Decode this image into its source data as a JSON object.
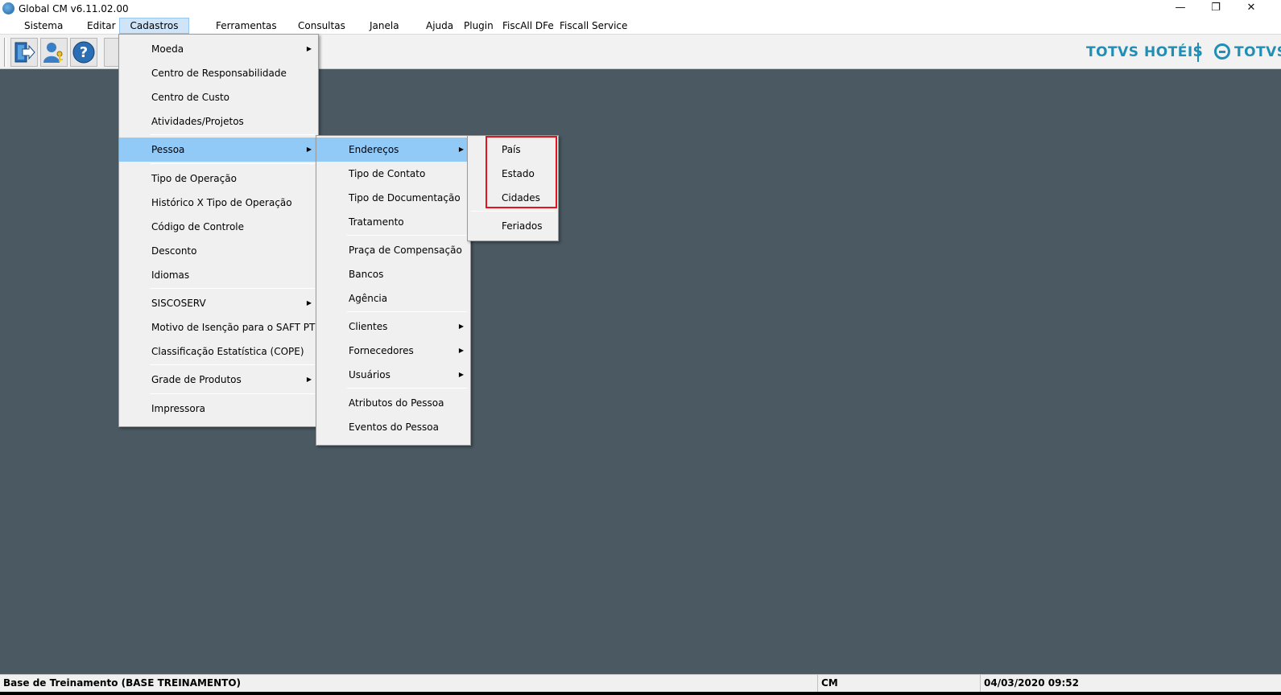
{
  "window": {
    "title": "Global CM v6.11.02.00",
    "minimize": "—",
    "maximize": "❐",
    "close": "✕"
  },
  "menubar": [
    "Sistema",
    "Editar",
    "Cadastros",
    "Ferramentas",
    "Consultas",
    "Janela",
    "Ajuda",
    "Plugin",
    "FiscAll DFe",
    "Fiscall Service"
  ],
  "toolbar": {
    "buttons": [
      "exit-icon",
      "user-key-icon",
      "help-icon"
    ],
    "brand_hotel": "TOTVS HOTÉIS",
    "brand_totvs": "TOTVS"
  },
  "menu_cadastros": {
    "moeda": "Moeda",
    "centro_resp": "Centro de Responsabilidade",
    "centro_custo": "Centro de Custo",
    "atividades": "Atividades/Projetos",
    "pessoa": "Pessoa",
    "tipo_operacao": "Tipo de Operação",
    "historico": "Histórico  X Tipo de Operação",
    "codigo_controle": "Código de Controle",
    "desconto": "Desconto",
    "idiomas": "Idiomas",
    "siscoserv": "SISCOSERV",
    "motivo_isencao": "Motivo de Isenção para o SAFT PT",
    "classificacao": "Classificação Estatística (COPE)",
    "grade_produtos": "Grade de Produtos",
    "impressora": "Impressora"
  },
  "menu_pessoa": {
    "enderecos": "Endereços",
    "tipo_contato": "Tipo de Contato",
    "tipo_documentacao": "Tipo de Documentação",
    "tratamento": "Tratamento",
    "praca": "Praça de Compensação",
    "bancos": "Bancos",
    "agencia": "Agência",
    "clientes": "Clientes",
    "fornecedores": "Fornecedores",
    "usuarios": "Usuários",
    "atributos": "Atributos do Pessoa",
    "eventos": "Eventos do Pessoa"
  },
  "menu_enderecos": {
    "pais": "País",
    "estado": "Estado",
    "cidades": "Cidades",
    "feriados": "Feriados"
  },
  "statusbar": {
    "database": "Base de Treinamento (BASE TREINAMENTO)",
    "module": "CM",
    "datetime": "04/03/2020 09:52"
  },
  "colors": {
    "workspace": "#4a5962",
    "menu_highlight": "#91c9f7",
    "brand": "#1f8fb8",
    "annotation_box": "#e3141c"
  }
}
